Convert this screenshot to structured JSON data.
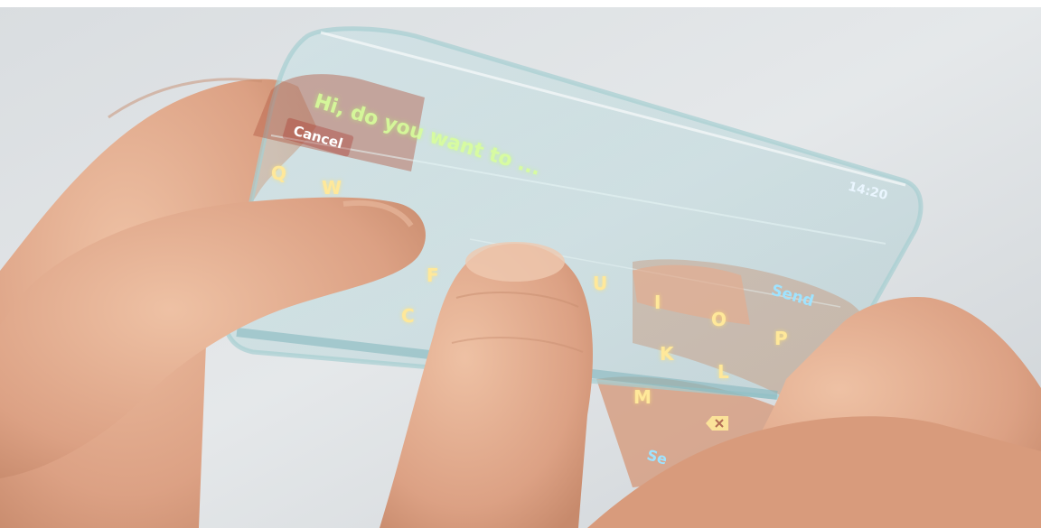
{
  "screen": {
    "message": "Hi, do you want to ...",
    "status_time": "14:20"
  },
  "buttons": {
    "cancel": "Cancel",
    "send": "Send",
    "send_lower": "Se"
  },
  "keyboard": {
    "keys": [
      "Q",
      "W",
      "F",
      "U",
      "I",
      "O",
      "P",
      "C",
      "K",
      "L",
      "M"
    ],
    "delete_icon": "backspace-icon"
  },
  "colors": {
    "message_text": "#d8ff9a",
    "key_text": "#ffe89a",
    "send_text": "#9fe3ff",
    "cancel_bar": "#aa3228"
  }
}
